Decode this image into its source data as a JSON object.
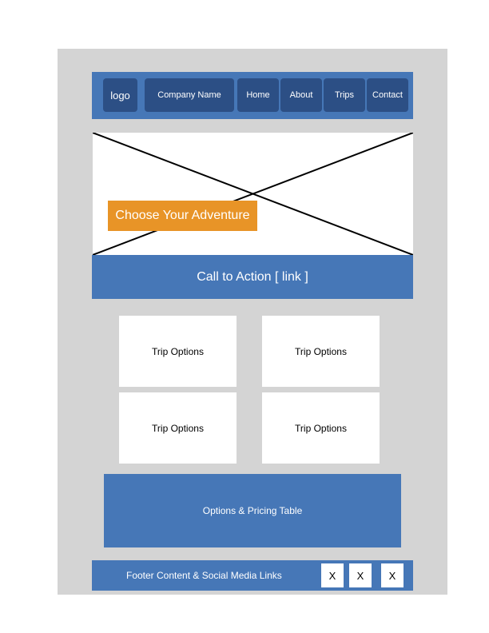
{
  "header": {
    "logo": "logo",
    "company_name": "Company Name",
    "nav": [
      {
        "label": "Home"
      },
      {
        "label": "About"
      },
      {
        "label": "Trips"
      },
      {
        "label": "Contact"
      }
    ]
  },
  "hero": {
    "label": "Choose Your Adventure",
    "image_placeholder": "image-placeholder-icon"
  },
  "cta": {
    "label": "Call to Action [ link ]"
  },
  "trips": [
    {
      "label": "Trip Options"
    },
    {
      "label": "Trip Options"
    },
    {
      "label": "Trip Options"
    },
    {
      "label": "Trip Options"
    }
  ],
  "pricing": {
    "label": "Options & Pricing Table"
  },
  "footer": {
    "text": "Footer Content & Social Media Links",
    "social": [
      {
        "label": "X",
        "icon": "social-link-icon"
      },
      {
        "label": "X",
        "icon": "social-link-icon"
      },
      {
        "label": "X",
        "icon": "social-link-icon"
      }
    ]
  },
  "colors": {
    "frame": "#d4d4d4",
    "primary_blue": "#4677b7",
    "nav_button": "#2c4f85",
    "accent_orange": "#e89427",
    "white": "#ffffff"
  }
}
